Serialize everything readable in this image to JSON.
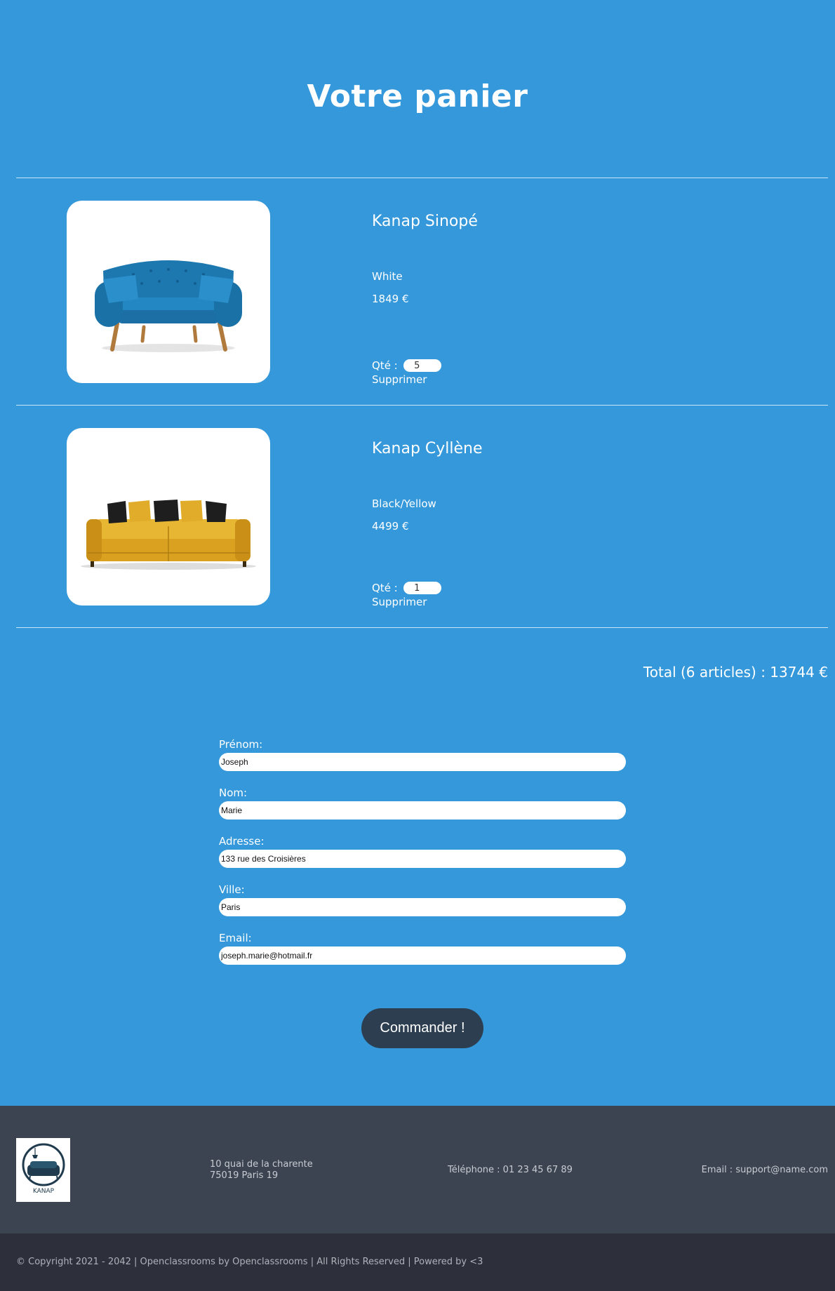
{
  "page": {
    "title": "Votre panier"
  },
  "cart": {
    "items": [
      {
        "name": "Kanap Sinopé",
        "color": "White",
        "price": "1849 €",
        "qty_label": "Qté :",
        "qty": "5",
        "delete_label": "Supprimer",
        "image_icon": "blue-sofa-image"
      },
      {
        "name": "Kanap Cyllène",
        "color": "Black/Yellow",
        "price": "4499 €",
        "qty_label": "Qté :",
        "qty": "1",
        "delete_label": "Supprimer",
        "image_icon": "yellow-sofa-image"
      }
    ],
    "total": "Total (6 articles) : 13744 €"
  },
  "form": {
    "first_name": {
      "label": "Prénom:",
      "value": "Joseph"
    },
    "last_name": {
      "label": "Nom:",
      "value": "Marie"
    },
    "address": {
      "label": "Adresse:",
      "value": "133 rue des Croisières"
    },
    "city": {
      "label": "Ville:",
      "value": "Paris"
    },
    "email": {
      "label": "Email:",
      "value": "joseph.marie@hotmail.fr"
    },
    "submit_label": "Commander !"
  },
  "footer": {
    "logo_text": "KANAP",
    "address_line1": "10 quai de la charente",
    "address_line2": "75019 Paris 19",
    "phone": "Téléphone : 01 23 45 67 89",
    "email": "Email : support@name.com",
    "copyright": "© Copyright 2021 - 2042 | Openclassrooms by Openclassrooms | All Rights Reserved | Powered by <3"
  },
  "colors": {
    "page_background": "#3498db",
    "button_background": "#2c3e50",
    "footer_background": "#3d4451",
    "copyright_background": "#2d303b"
  }
}
